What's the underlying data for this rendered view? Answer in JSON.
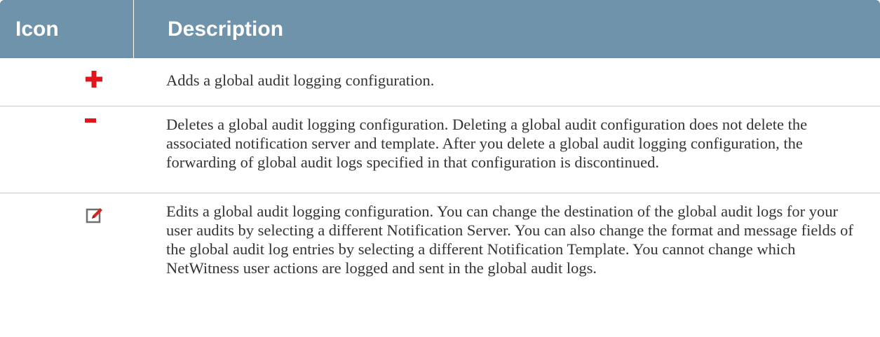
{
  "header": {
    "icon_label": "Icon",
    "description_label": "Description"
  },
  "rows": [
    {
      "icon": "plus-icon",
      "description": "Adds a global audit logging configuration."
    },
    {
      "icon": "minus-icon",
      "description": "Deletes a global audit logging configuration. Deleting a global audit configuration does not delete the associated notification server and template. After you delete a global audit logging configuration, the forwarding of global audit logs specified in that configuration is discontinued."
    },
    {
      "icon": "edit-icon",
      "description": "Edits a global audit logging configuration. You can change the destination of the global audit logs for your user audits by selecting a different Notification Server. You can also change the format and message fields of the global audit log entries by selecting a different Notification Template. You cannot change which NetWitness user actions are logged and sent in the global audit logs."
    }
  ],
  "colors": {
    "header_bg": "#6e93ab",
    "plus_red": "#e0161b",
    "edit_red": "#d0281e"
  }
}
